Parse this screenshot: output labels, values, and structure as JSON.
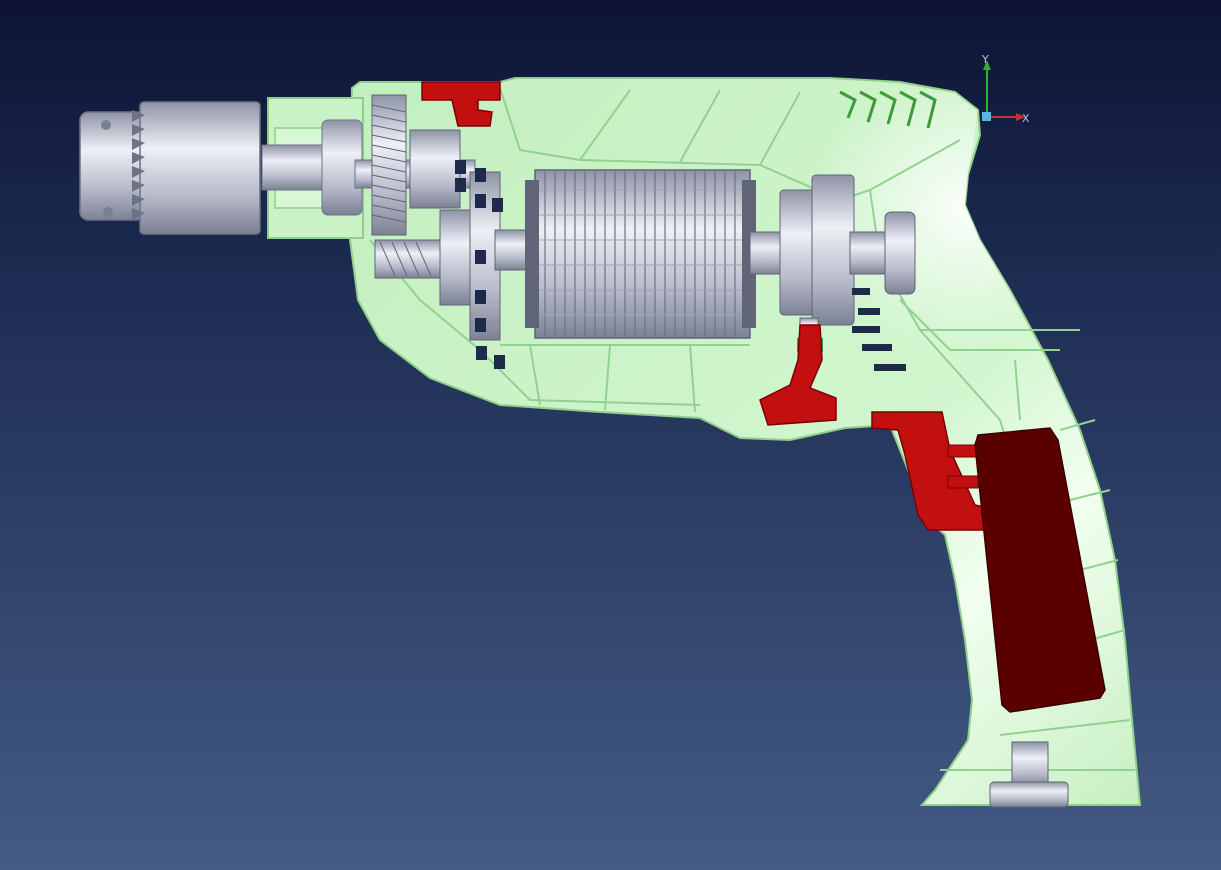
{
  "viewport": {
    "background_top": "#0d1433",
    "background_bottom": "#435b85"
  },
  "triad": {
    "y_label": "Y",
    "x_label": "X",
    "y_color": "#2fae3a",
    "x_color": "#c43030",
    "origin_color": "#5bb6e0"
  },
  "model": {
    "housing_color": "#c9f2c6",
    "housing_outline": "#8fcf8a",
    "rib_color": "#9bd69a",
    "red_parts_color": "#c21010",
    "dark_red_color": "#5a0000",
    "metal_color": "#c8ccd8",
    "slot_color": "#1e2a4a",
    "vent_color": "#3f9a3a"
  }
}
